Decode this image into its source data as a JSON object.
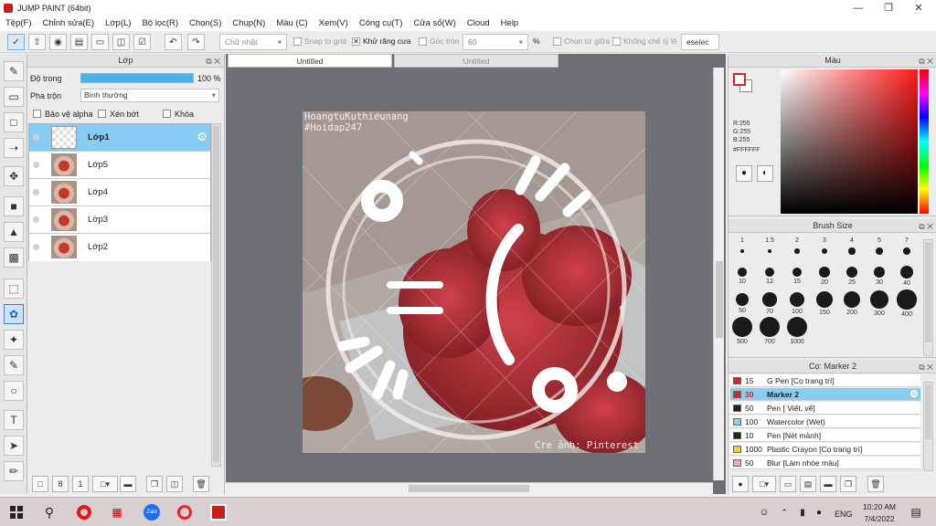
{
  "window": {
    "title": "JUMP PAINT (64bit)"
  },
  "menu": [
    "Tệp(F)",
    "Chỉnh sửa(E)",
    "Lớp(L)",
    "Bộ lọc(R)",
    "Chọn(S)",
    "Chụp(N)",
    "Màu (C)",
    "Xem(V)",
    "Công cụ(T)",
    "Cửa sổ(W)",
    "Cloud",
    "Help"
  ],
  "toolbar": {
    "shape_select": "Chữ nhật",
    "snap_to_grid": "Snap to grid",
    "antialias": "Khử răng cưa",
    "round_corner": "Góc tròn",
    "round_value": "60",
    "percent": "%",
    "select_center": "Chọn từ giữa",
    "ratio_lock": "Không chế tỷ lệ",
    "deselect": "eselec"
  },
  "layer_panel": {
    "title": "Lớp",
    "opacity_label": "Độ trong",
    "opacity_value": "100 %",
    "opacity": 1.0,
    "blend_label": "Pha trộn",
    "blend_value": "Bình thường",
    "protect_alpha": "Bảo vệ alpha",
    "clip": "Xén bớt",
    "lock": "Khóa",
    "layers": [
      {
        "name": "Lớp1",
        "selected": true
      },
      {
        "name": "Lớp5",
        "selected": false
      },
      {
        "name": "Lớp4",
        "selected": false
      },
      {
        "name": "Lớp3",
        "selected": false
      },
      {
        "name": "Lớp2",
        "selected": false
      }
    ]
  },
  "canvas": {
    "tabs": [
      "Untitled",
      "Untitled"
    ],
    "watermark_top_1": "HoangtuKuthieunang",
    "watermark_top_2": "#Hoidap247",
    "watermark_bottom": "Cre ảnh: Pinterest"
  },
  "color_panel": {
    "title": "Màu",
    "r": "R:255",
    "g": "G:255",
    "b": "B:255",
    "hex": "#FFFFFF"
  },
  "brush_size_panel": {
    "title": "Brush Size",
    "sizes": [
      "1",
      "1.5",
      "2",
      "3",
      "4",
      "5",
      "7",
      "10",
      "12",
      "15",
      "20",
      "25",
      "30",
      "40",
      "50",
      "70",
      "100",
      "150",
      "200",
      "300",
      "400",
      "500",
      "700",
      "1000"
    ]
  },
  "brush_panel": {
    "title": "Cọ: Marker 2",
    "brushes": [
      {
        "size": "15",
        "name": "G Pen [Cọ trang trí]",
        "color": "#e02020"
      },
      {
        "size": "30",
        "name": "Marker 2",
        "color": "#e02020",
        "selected": true
      },
      {
        "size": "50",
        "name": "Pen [ Viết, vẽ]",
        "color": "#222222"
      },
      {
        "size": "100",
        "name": "Watercolor (Wet)",
        "color": "#7fd6ef"
      },
      {
        "size": "10",
        "name": "Pen [Nét mảnh]",
        "color": "#222222"
      },
      {
        "size": "1000",
        "name": "Plastic Crayon [Cọ trang trí]",
        "color": "#f0d020"
      },
      {
        "size": "50",
        "name": "Blur [Làm nhòe màu]",
        "color": "#f4a0c8"
      }
    ]
  },
  "taskbar": {
    "lang": "ENG",
    "time": "10:20 AM",
    "date": "7/4/2022"
  }
}
